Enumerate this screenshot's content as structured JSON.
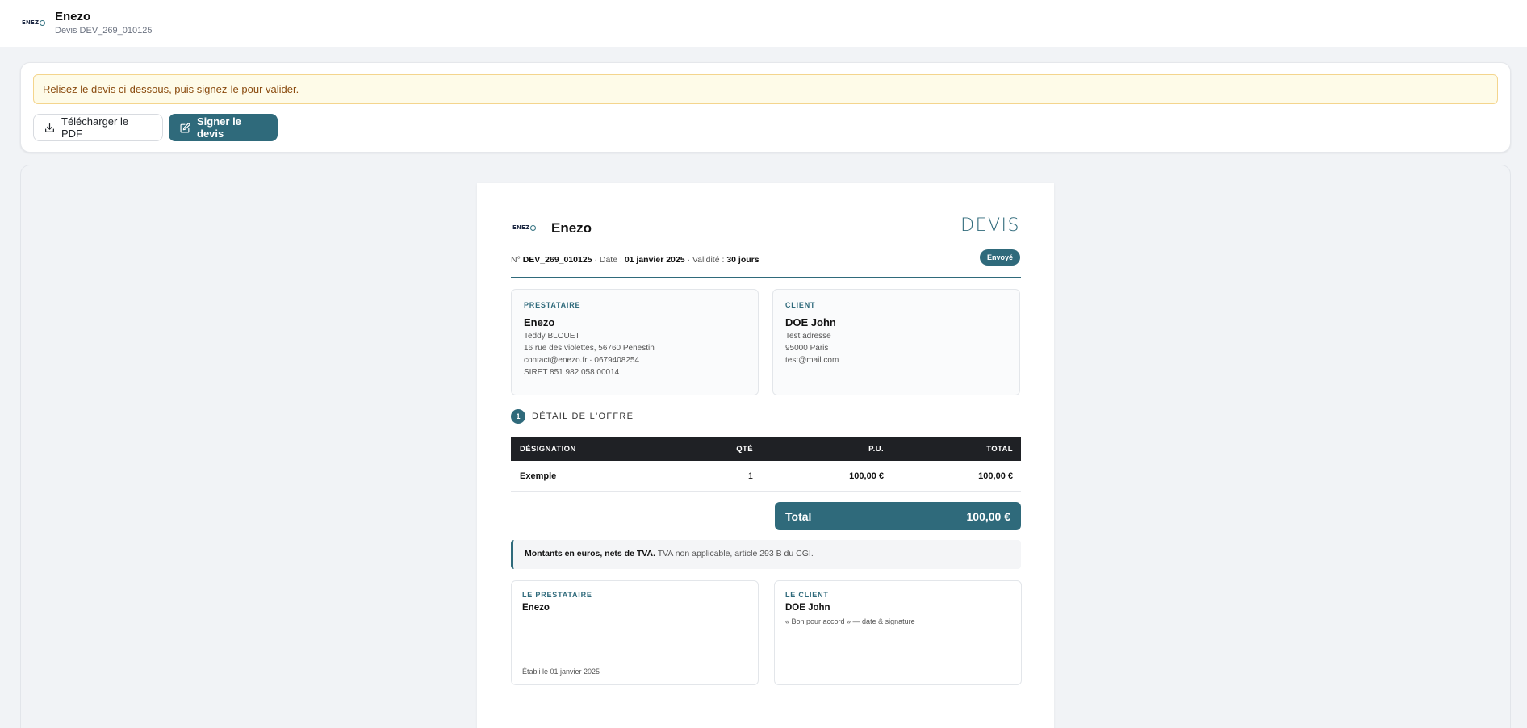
{
  "header": {
    "logo_text": "ENEZ",
    "company": "Enezo",
    "subtitle": "Devis DEV_269_010125"
  },
  "actions": {
    "notice": "Relisez le devis ci-dessous, puis signez-le pour valider.",
    "download_label": "Télécharger le PDF",
    "sign_label": "Signer le devis"
  },
  "document": {
    "logo_text": "ENEZ",
    "company": "Enezo",
    "title": "DEVIS",
    "meta": {
      "number_label": "N°",
      "number": "DEV_269_010125",
      "date_label": "· Date :",
      "date": "01 janvier 2025",
      "validity_label": "· Validité :",
      "validity": "30 jours"
    },
    "status": "Envoyé",
    "provider": {
      "label": "PRESTATAIRE",
      "name": "Enezo",
      "lines": [
        "Teddy BLOUET",
        "16 rue des violettes, 56760 Penestin",
        "contact@enezo.fr · 0679408254",
        "SIRET 851 982 058 00014"
      ]
    },
    "client": {
      "label": "CLIENT",
      "name": "DOE John",
      "lines": [
        "Test adresse",
        "95000 Paris",
        "test@mail.com"
      ]
    },
    "section": {
      "number": "1",
      "title": "DÉTAIL DE L'OFFRE"
    },
    "table": {
      "headers": [
        "DÉSIGNATION",
        "QTÉ",
        "P.U.",
        "TOTAL"
      ],
      "rows": [
        [
          "Exemple",
          "1",
          "100,00 €",
          "100,00 €"
        ]
      ]
    },
    "total": {
      "label": "Total",
      "value": "100,00 €"
    },
    "vat_note": {
      "bold": "Montants en euros, nets de TVA.",
      "text": "TVA non applicable, article 293 B du CGI."
    },
    "signature_provider": {
      "label": "LE PRESTATAIRE",
      "name": "Enezo",
      "date": "Établi le 01 janvier 2025"
    },
    "signature_client": {
      "label": "LE CLIENT",
      "name": "DOE John",
      "note": "« Bon pour accord » — date & signature"
    }
  },
  "colors": {
    "accent": "#2f6a7b",
    "notice_bg": "#fefbe8",
    "notice_text": "#8a4b0f",
    "table_head": "#1f2125"
  }
}
